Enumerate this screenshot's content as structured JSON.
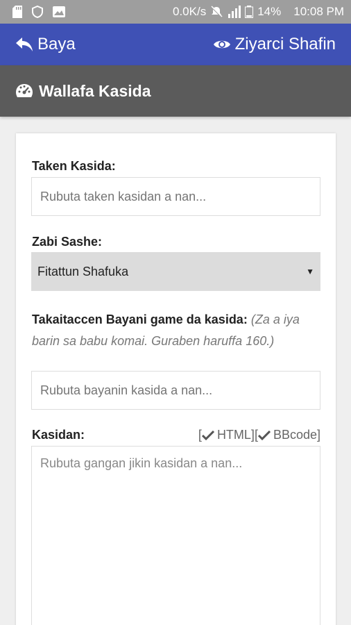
{
  "status_bar": {
    "speed": "0.0K/s",
    "battery": "14%",
    "time": "10:08 PM"
  },
  "app_bar": {
    "back_label": "Baya",
    "preview_label": "Ziyarci Shafin",
    "color": "#3f51b5"
  },
  "sub_header": {
    "title": "Wallafa Kasida"
  },
  "form": {
    "title_label": "Taken Kasida:",
    "title_placeholder": "Rubuta taken kasidan a nan...",
    "section_label": "Zabi Sashe:",
    "section_value": "Fitattun Shafuka",
    "summary_label": "Takaitaccen Bayani game da kasida:",
    "summary_note": "(Za a iya barin sa babu komai. Guraben haruffa 160.)",
    "summary_placeholder": "Rubuta bayanin kasida a nan...",
    "content_label": "Kasidan:",
    "format_open": "[",
    "format_html": "HTML]",
    "format_bbcode_open": "[",
    "format_bbcode": "BBcode]",
    "content_placeholder": "Rubuta gangan jikin kasidan a nan..."
  },
  "icons": {
    "back": "reply-arrow-icon",
    "preview": "eye-icon",
    "header": "dashboard-gauge-icon",
    "check": "check-icon"
  }
}
